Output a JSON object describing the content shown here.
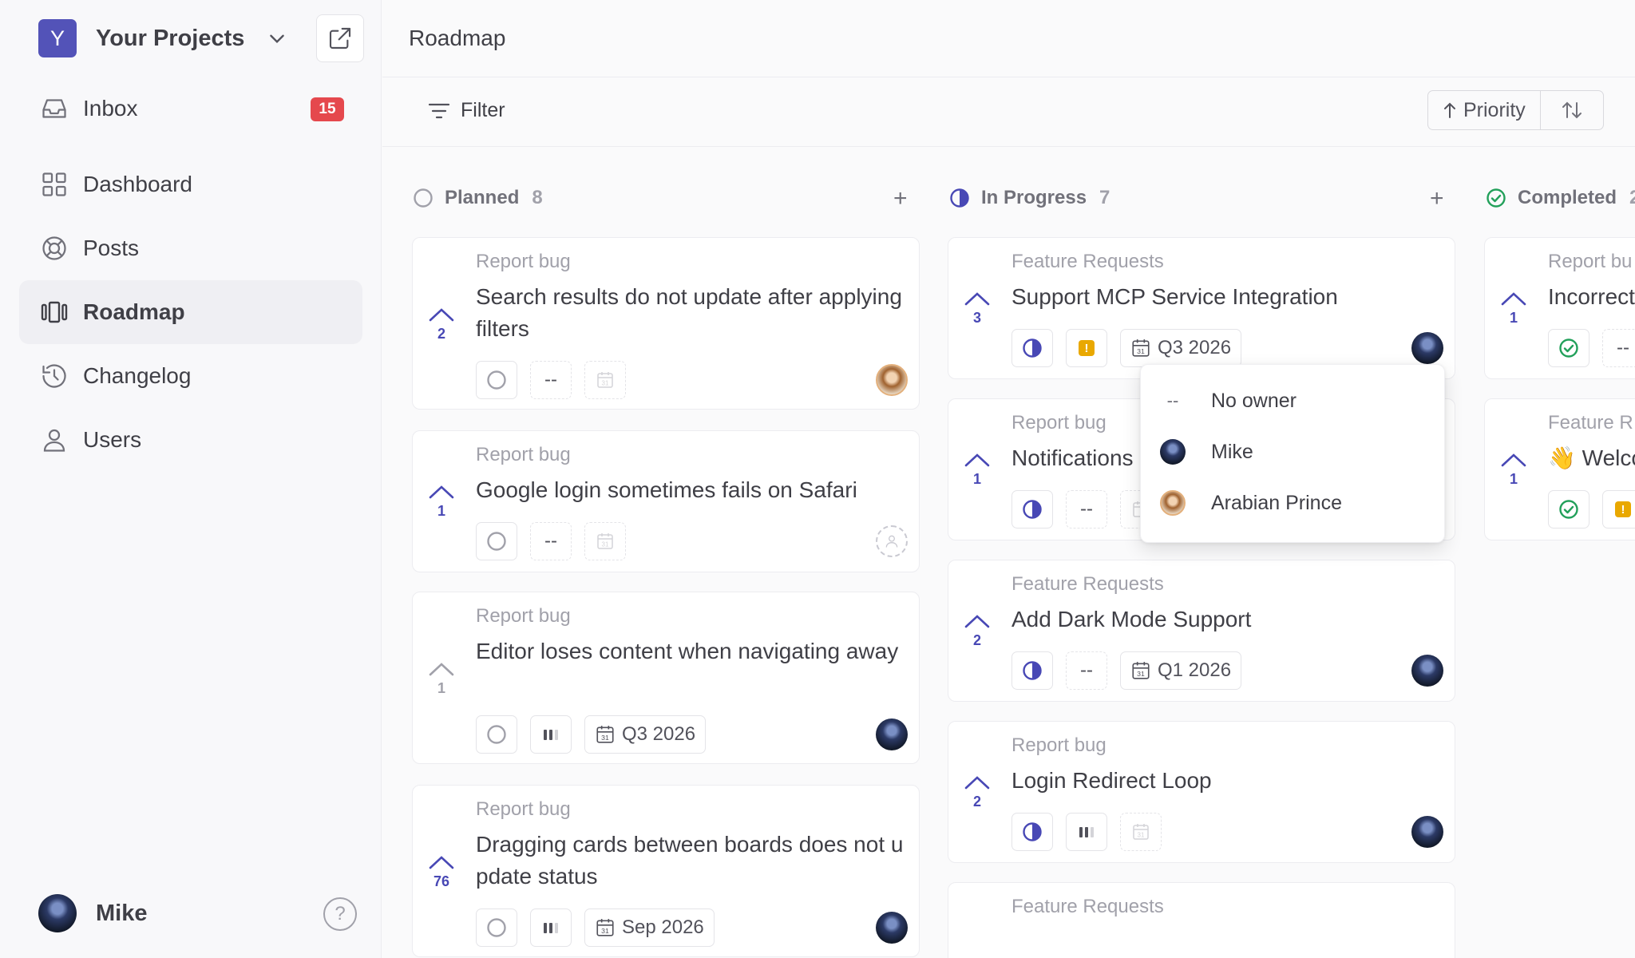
{
  "sidebar": {
    "project_initial": "Y",
    "project_name": "Your Projects",
    "items": [
      {
        "label": "Inbox",
        "badge": "15"
      },
      {
        "label": "Dashboard"
      },
      {
        "label": "Posts"
      },
      {
        "label": "Roadmap"
      },
      {
        "label": "Changelog"
      },
      {
        "label": "Users"
      }
    ],
    "user_name": "Mike",
    "help_glyph": "?"
  },
  "header": {
    "title": "Roadmap"
  },
  "toolbar": {
    "filter_label": "Filter",
    "sort_label": "Priority"
  },
  "columns": [
    {
      "name": "Planned",
      "count": "8",
      "cards": [
        {
          "category": "Report bug",
          "title": "Search results do not update after applying filters",
          "votes": "2",
          "chips": [
            "--"
          ]
        },
        {
          "category": "Report bug",
          "title": "Google login sometimes fails on Safari",
          "votes": "1",
          "chips": [
            "--"
          ]
        },
        {
          "category": "Report bug",
          "title": "Editor loses content when navigating away",
          "votes": "1",
          "chips": [
            "Q3 2026"
          ]
        },
        {
          "category": "Report bug",
          "title": "Dragging cards between boards does not update status",
          "votes": "76",
          "chips": [
            "Sep 2026"
          ]
        }
      ]
    },
    {
      "name": "In Progress",
      "count": "7",
      "cards": [
        {
          "category": "Feature Requests",
          "title": "Support MCP Service Integration",
          "votes": "3",
          "chips": [
            "Q3 2026"
          ]
        },
        {
          "category": "Report bug",
          "title": "Notifications",
          "votes": "1",
          "chips": [
            "--"
          ]
        },
        {
          "category": "Feature Requests",
          "title": "Add Dark Mode Support",
          "votes": "2",
          "chips": [
            "--",
            "Q1 2026"
          ]
        },
        {
          "category": "Report bug",
          "title": "Login Redirect Loop",
          "votes": "2",
          "chips": []
        },
        {
          "category": "Feature Requests",
          "title": "",
          "votes": "",
          "chips": []
        }
      ]
    },
    {
      "name": "Completed",
      "count": "2",
      "cards": [
        {
          "category": "Report bu",
          "title": "Incorrect",
          "votes": "1",
          "chips": [
            "--"
          ]
        },
        {
          "category": "Feature R",
          "title": "👋 Welco",
          "votes": "1",
          "chips": []
        }
      ]
    }
  ],
  "owner_dropdown": {
    "options": [
      {
        "icon": "--",
        "label": "No owner"
      },
      {
        "label": "Mike"
      },
      {
        "label": "Arabian Prince"
      }
    ]
  },
  "colors": {
    "accent": "#4848b5",
    "badge": "#e5484d",
    "completed": "#22a05a",
    "priority_high": "#e9a800"
  }
}
